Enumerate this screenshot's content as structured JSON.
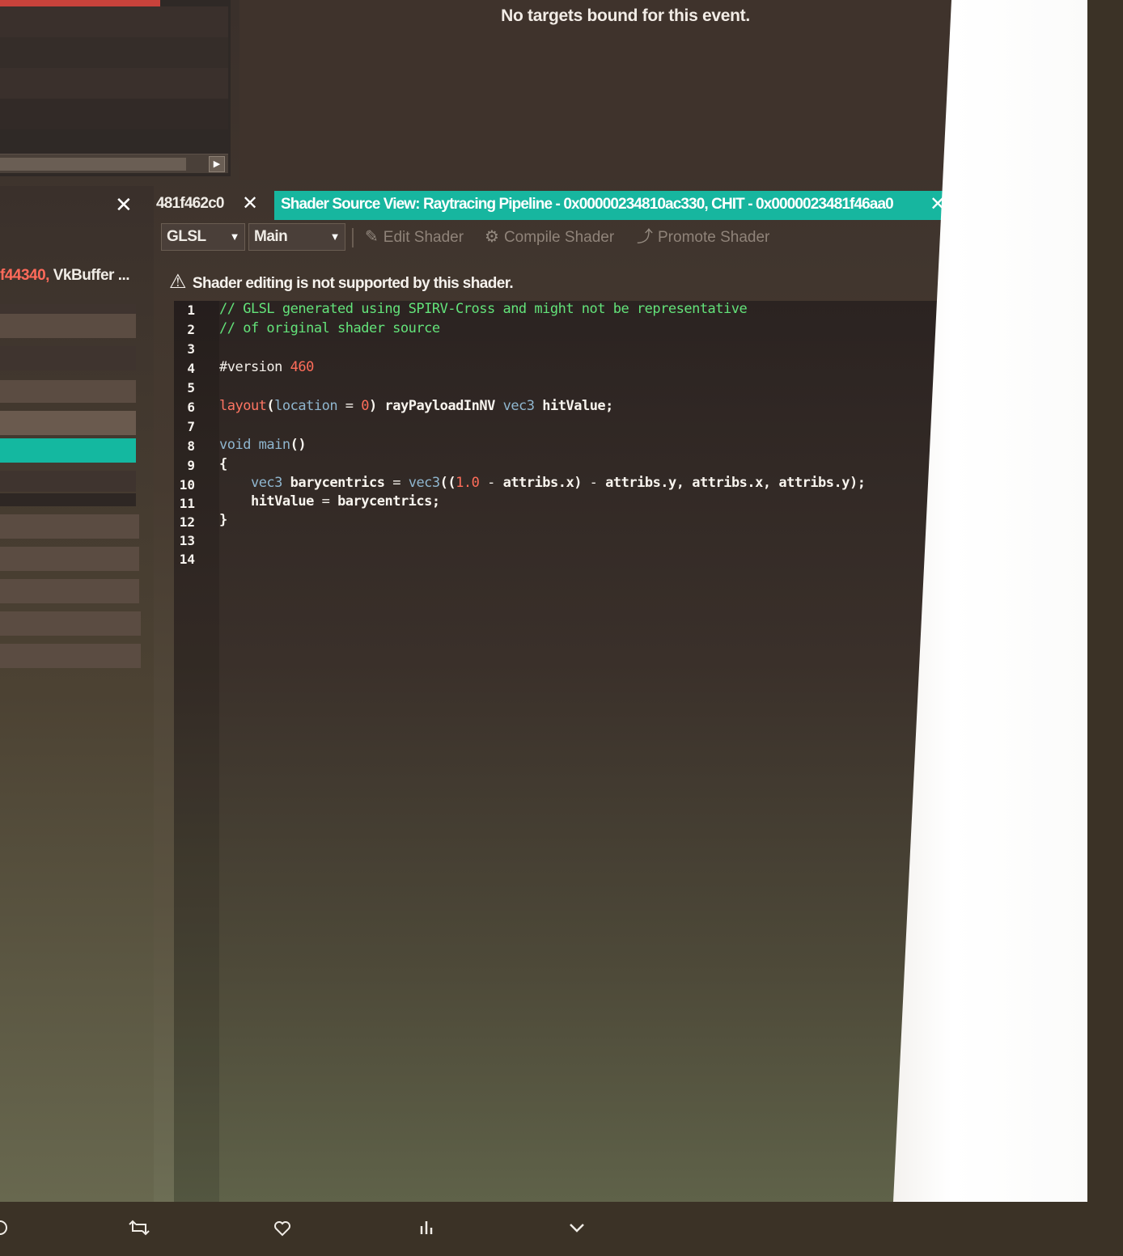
{
  "texture_viewer": {
    "message": "No targets bound for this event."
  },
  "left_panel": {
    "close_glyph": "✕",
    "resource_ref_red": "f44340,",
    "resource_ref_white": " VkBuffer ..."
  },
  "tabs": {
    "previous_tab_label": "481f462c0",
    "previous_close": "✕",
    "active_tab_label": "Shader Source View: Raytracing Pipeline - 0x00000234810ac330, CHIT - 0x0000023481f46aa0",
    "active_close": "✕",
    "nav_prev": "◀",
    "nav_next": "▶"
  },
  "toolbar": {
    "language_select": "GLSL",
    "entry_select": "Main",
    "edit_shader": "Edit Shader",
    "compile_shader": "Compile Shader",
    "promote_shader": "Promote Shader"
  },
  "warning": {
    "icon": "⚠",
    "text": "Shader editing is not supported by this shader."
  },
  "editor": {
    "line_numbers": [
      "1",
      "2",
      "3",
      "4",
      "5",
      "6",
      "7",
      "8",
      "9",
      "10",
      "11",
      "12",
      "13",
      "14"
    ],
    "lines": [
      "// GLSL generated using SPIRV-Cross and might not be representative",
      "// of original shader source",
      "",
      "#version 460",
      "",
      "layout(location = 0) rayPayloadInNV vec3 hitValue;",
      "",
      "void main()",
      "{",
      "    vec3 barycentrics = vec3((1.0 - attribs.x) - attribs.y, attribs.x, attribs.y);",
      "    hitValue = barycentrics;",
      "}",
      "",
      ""
    ]
  },
  "bottom_bar": {
    "icons": [
      "reply-icon",
      "retweet-icon",
      "like-icon",
      "analytics-icon",
      "more-icon"
    ]
  },
  "colors": {
    "accent_teal": "#17b69f",
    "comment_green": "#63e37a",
    "number_red": "#ff6d5a",
    "keyword_blue": "#63b8d8"
  }
}
